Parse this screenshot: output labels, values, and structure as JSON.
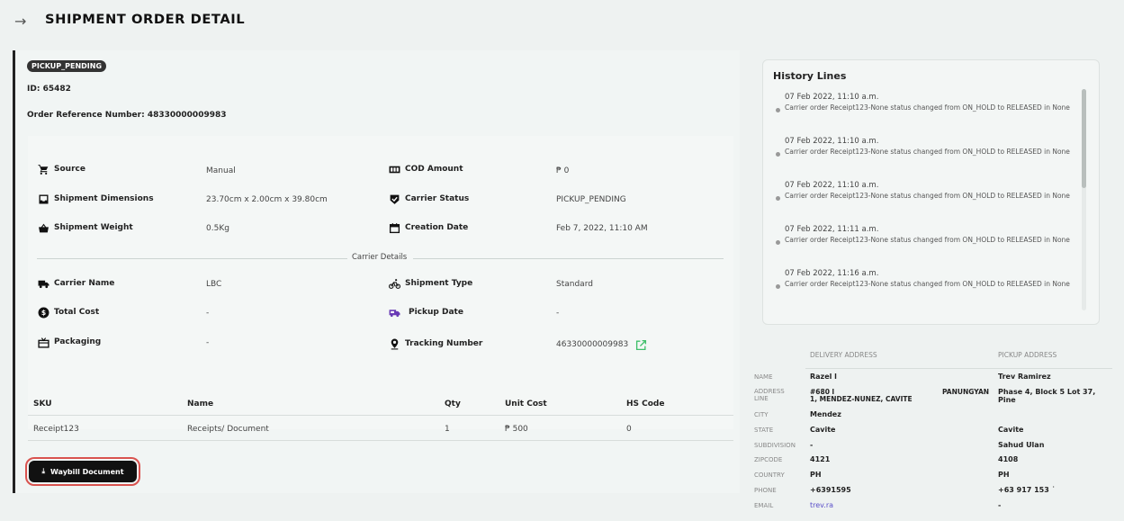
{
  "header": {
    "back_icon": "arrow-right-icon",
    "title": "SHIPMENT ORDER DETAIL"
  },
  "order": {
    "status_badge": "PICKUP_PENDING",
    "id_label": "ID:",
    "id_value": "65482",
    "ref_label": "Order Reference Number:",
    "ref_value": "48330000009983"
  },
  "details": {
    "source_label": "Source",
    "source_value": "Manual",
    "dims_label": "Shipment Dimensions",
    "dims_value": "23.70cm x 2.00cm x 39.80cm",
    "weight_label": "Shipment Weight",
    "weight_value": "0.5Kg",
    "cod_label": "COD Amount",
    "cod_value": "₱ 0",
    "carrier_status_label": "Carrier Status",
    "carrier_status_value": "PICKUP_PENDING",
    "creation_label": "Creation Date",
    "creation_value": "Feb 7, 2022, 11:10 AM"
  },
  "carrier": {
    "section_label": "Carrier Details",
    "name_label": "Carrier Name",
    "name_value": "LBC",
    "cost_label": "Total Cost",
    "cost_value": "-",
    "packaging_label": "Packaging",
    "packaging_value": "-",
    "type_label": "Shipment Type",
    "type_value": "Standard",
    "pickup_label": "Pickup Date",
    "pickup_value": "-",
    "tracking_label": "Tracking Number",
    "tracking_value": "46330000009983"
  },
  "items": {
    "headers": [
      "SKU",
      "Name",
      "Qty",
      "Unit Cost",
      "HS Code"
    ],
    "rows": [
      [
        "Receipt123",
        "Receipts/ Document",
        "1",
        "₱ 500",
        "0"
      ]
    ]
  },
  "waybill_button": "Waybill Document",
  "history": {
    "title": "History Lines",
    "entries": [
      {
        "date": "07 Feb 2022, 11:10 a.m.",
        "text": "Carrier order Receipt123-None status changed from ON_HOLD to RELEASED in None"
      },
      {
        "date": "07 Feb 2022, 11:10 a.m.",
        "text": "Carrier order Receipt123-None status changed from ON_HOLD to RELEASED in None"
      },
      {
        "date": "07 Feb 2022, 11:10 a.m.",
        "text": "Carrier order Receipt123-None status changed from ON_HOLD to RELEASED in None"
      },
      {
        "date": "07 Feb 2022, 11:11 a.m.",
        "text": "Carrier order Receipt123-None status changed from ON_HOLD to RELEASED in None"
      },
      {
        "date": "07 Feb 2022, 11:16 a.m.",
        "text": "Carrier order Receipt123-None status changed from ON_HOLD to RELEASED in None"
      }
    ]
  },
  "address": {
    "delivery_header": "DELIVERY ADDRESS",
    "pickup_header": "PICKUP ADDRESS",
    "labels": {
      "name": "NAME",
      "address_line_1": "ADDRESS",
      "address_line_2": "LINE",
      "city": "CITY",
      "state": "STATE",
      "subdivision": "SUBDIVISION",
      "zipcode": "ZIPCODE",
      "country": "COUNTRY",
      "phone": "PHONE",
      "email": "EMAIL"
    },
    "delivery": {
      "name": "Razel l",
      "address_1": "#680 l",
      "address_2": "1, MENDEZ-NUNEZ, CAVITE",
      "address_extra": "PANUNGYAN",
      "city": "Mendez",
      "state": "Cavite",
      "subdivision": "-",
      "zipcode": "4121",
      "country": "PH",
      "phone": "+6391595",
      "email": "trev.ra"
    },
    "pickup": {
      "name": "Trev Ramirez",
      "address_1": "Phase 4, Block 5 Lot 37, Pine",
      "city": "",
      "state": "Cavite",
      "subdivision": "Sahud Ulan",
      "zipcode": "4108",
      "country": "PH",
      "phone": "+63 917 153 ˙",
      "email": "-"
    }
  }
}
